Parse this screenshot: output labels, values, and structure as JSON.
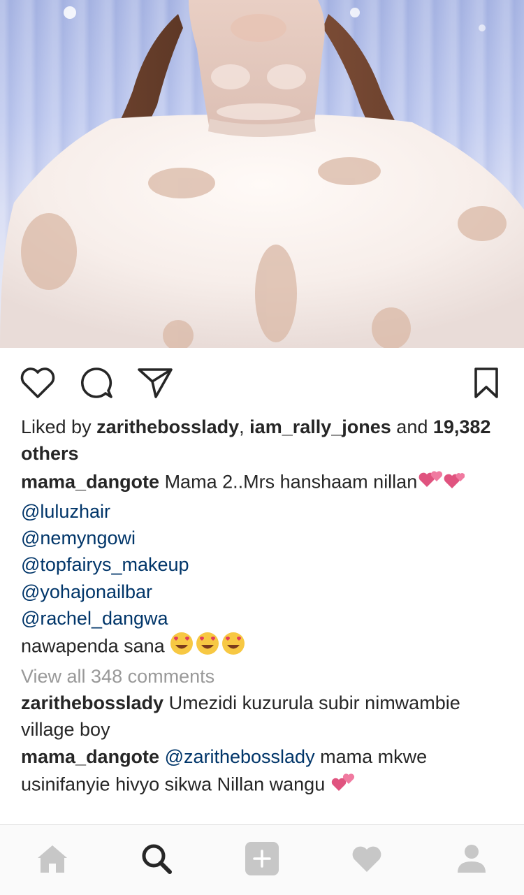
{
  "post": {
    "photo_icon": "wedding-dress-photo",
    "likes": {
      "prefix": "Liked by ",
      "user1": "zarithebosslady",
      "sep": ", ",
      "user2": "iam_rally_jones",
      "mid": " and ",
      "count": "19,382",
      "others": "others"
    },
    "caption": {
      "username": "mama_dangote",
      "text": " Mama 2..Mrs hanshaam nillan",
      "mentions": [
        "@luluzhair",
        "@nemyngowi",
        "@topfairys_makeup",
        "@yohajonailbar",
        "@rachel_dangwa"
      ],
      "closing": "nawapenda sana "
    },
    "view_all": "View all 348 comments",
    "comments": [
      {
        "username": "zarithebosslady",
        "text": " Umezidi kuzurula subir nimwambie village boy"
      },
      {
        "username": "mama_dangote",
        "mention": " @zarithebosslady",
        "text": " mama mkwe usinifanyie hivyo sikwa Nillan wangu "
      }
    ]
  },
  "icons": {
    "like": "heart-outline-icon",
    "comment": "comment-bubble-icon",
    "share": "paper-plane-icon",
    "save": "bookmark-icon",
    "nav": [
      "home-icon",
      "search-icon",
      "add-post-icon",
      "activity-heart-icon",
      "profile-icon"
    ]
  },
  "colors": {
    "text": "#262626",
    "mention": "#003569",
    "muted": "#999999",
    "nav_icon": "#c7c7c7",
    "nav_active": "#262626",
    "emoji_heart": "#e0537f"
  }
}
